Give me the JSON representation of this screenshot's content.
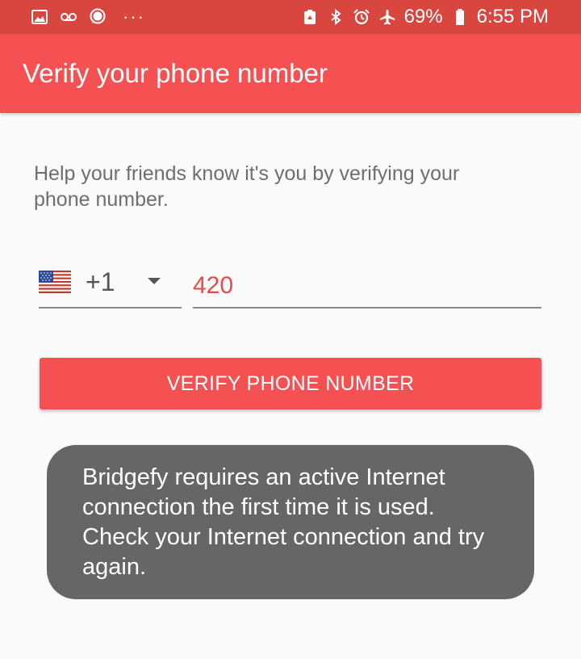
{
  "status_bar": {
    "battery_percent": "69%",
    "time": "6:55 PM",
    "dots": "···",
    "icons_left": [
      "image-icon",
      "voicemail-icon",
      "chat-bubble-icon"
    ],
    "icons_right": [
      "battery-saver-icon",
      "bluetooth-icon",
      "alarm-icon",
      "airplane-icon",
      "battery-icon"
    ]
  },
  "app_bar": {
    "title": "Verify your phone number"
  },
  "main": {
    "help_text": "Help your friends know it's you by verifying your phone number.",
    "country": {
      "flag": "us-flag-icon",
      "dial_code": "+1"
    },
    "phone_input": {
      "value": "420"
    },
    "verify_button_label": "VERIFY PHONE NUMBER"
  },
  "toast": {
    "message": "Bridgefy requires an active Internet connection the first time it is used. Check your Internet connection and try again."
  },
  "colors": {
    "status_bar": "#d8463f",
    "app_bar": "#f55152",
    "accent_text": "#e84a4a",
    "toast_bg": "#666666"
  }
}
